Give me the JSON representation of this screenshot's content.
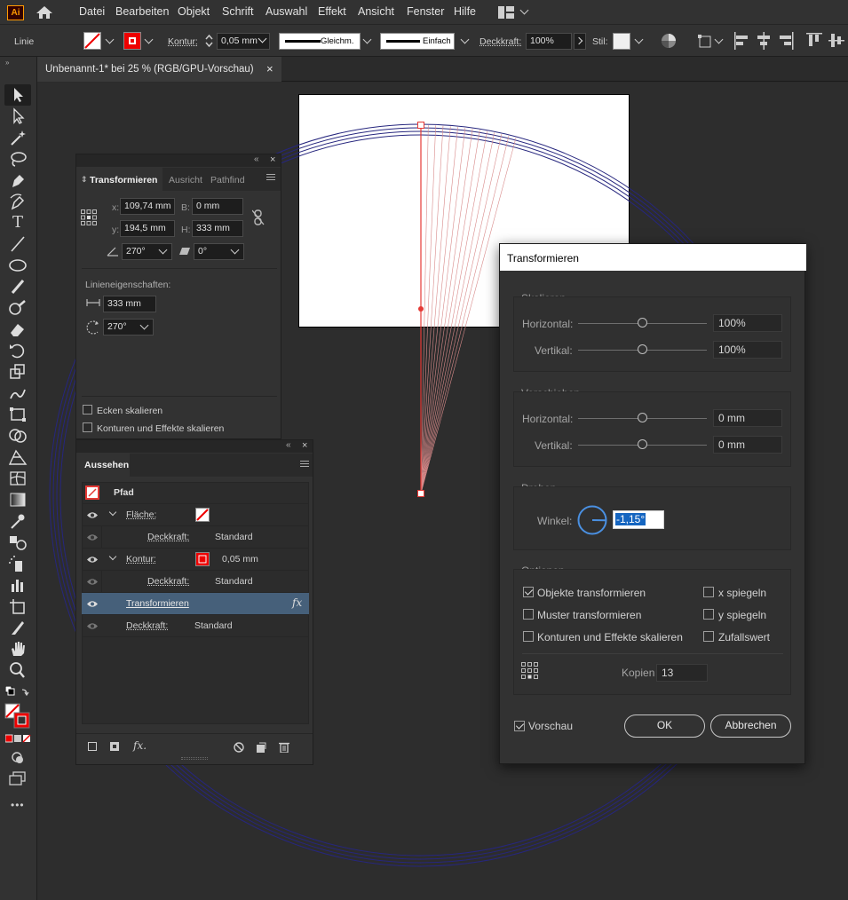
{
  "app": {
    "logo": "Ai"
  },
  "menu": [
    "Datei",
    "Bearbeiten",
    "Objekt",
    "Schrift",
    "Auswahl",
    "Effekt",
    "Ansicht",
    "Fenster",
    "Hilfe"
  ],
  "control_bar": {
    "selection_type": "Linie",
    "stroke_label": "Kontur:",
    "stroke_weight": "0,05 mm",
    "profile": "Gleichm.",
    "brush": "Einfach",
    "opacity_label": "Deckkraft:",
    "opacity": "100%",
    "style_label": "Stil:"
  },
  "document_tab": {
    "title": "Unbenannt-1* bei 25 % (RGB/GPU-Vorschau)",
    "close": "×"
  },
  "transform_panel": {
    "tabs": [
      "Transformieren",
      "Ausricht",
      "Pathfind"
    ],
    "x_label": "x:",
    "x": "109,74 mm",
    "y_label": "y:",
    "y": "194,5 mm",
    "w_label": "B:",
    "w": "0 mm",
    "h_label": "H:",
    "h": "333 mm",
    "angle": "270°",
    "shear": "0°",
    "line_props_label": "Linieneigenschaften:",
    "line_length": "333 mm",
    "line_angle": "270°",
    "scale_corners": "Ecken skalieren",
    "scale_strokes": "Konturen und Effekte skalieren"
  },
  "appearance_panel": {
    "tab": "Aussehen",
    "object": "Pfad",
    "fill_label": "Fläche:",
    "fill_opacity_label": "Deckkraft:",
    "fill_opacity": "Standard",
    "stroke_label": "Kontur:",
    "stroke_weight": "0,05 mm",
    "stroke_opacity_label": "Deckkraft:",
    "stroke_opacity": "Standard",
    "effect": "Transformieren",
    "effect_fx": "fx",
    "opacity_label": "Deckkraft:",
    "opacity": "Standard",
    "footer_fx": "fx."
  },
  "dialog": {
    "title": "Transformieren",
    "scale_group": "Skalieren",
    "scale_h_label": "Horizontal:",
    "scale_h": "100%",
    "scale_v_label": "Vertikal:",
    "scale_v": "100%",
    "move_group": "Verschieben",
    "move_h_label": "Horizontal:",
    "move_h": "0 mm",
    "move_v_label": "Vertikal:",
    "move_v": "0 mm",
    "rotate_group": "Drehen",
    "angle_label": "Winkel:",
    "angle": "-1,15°",
    "options_group": "Optionen",
    "opt_objects": "Objekte transformieren",
    "opt_patterns": "Muster transformieren",
    "opt_strokes": "Konturen und Effekte skalieren",
    "opt_reflect_x": "x spiegeln",
    "opt_reflect_y": "y spiegeln",
    "opt_random": "Zufallswert",
    "copies_label": "Kopien",
    "copies": "13",
    "preview": "Vorschau",
    "ok": "OK",
    "cancel": "Abbrechen"
  },
  "colors": {
    "accent": "#4a90e2",
    "selection": "#e53935",
    "circle": "#2a2a8c"
  },
  "icons": [
    "home-icon",
    "workspace-icon",
    "chevron-down-icon",
    "selection-tool-icon",
    "direct-selection-tool-icon",
    "magic-wand-icon",
    "lasso-icon",
    "pen-tool-icon",
    "curvature-icon",
    "type-tool-icon",
    "line-tool-icon",
    "ellipse-tool-icon",
    "paintbrush-icon",
    "blob-brush-icon",
    "eraser-icon",
    "rotate-tool-icon",
    "scale-tool-icon",
    "warp-tool-icon",
    "free-transform-icon",
    "shape-builder-icon",
    "perspective-icon",
    "mesh-icon",
    "gradient-icon",
    "eyedropper-icon",
    "blend-icon",
    "symbol-sprayer-icon",
    "graph-icon",
    "artboard-icon",
    "slice-icon",
    "hand-icon",
    "zoom-icon",
    "eye-icon",
    "link-icon",
    "reference-point-icon",
    "rotate-dial-icon"
  ]
}
